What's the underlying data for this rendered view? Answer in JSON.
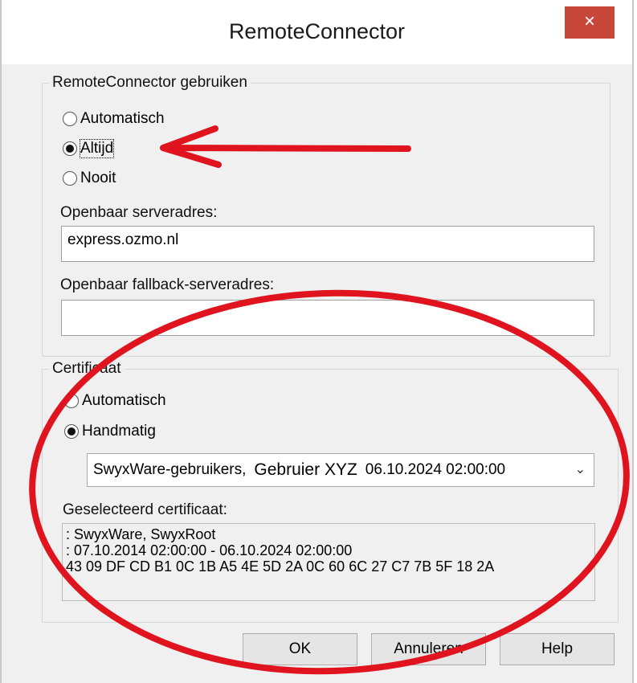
{
  "window": {
    "title": "RemoteConnector",
    "close_label": "×"
  },
  "usage_group": {
    "legend": "RemoteConnector gebruiken",
    "options": [
      "Automatisch",
      "Altijd",
      "Nooit"
    ],
    "selected": "Altijd",
    "server_label": "Openbaar serveradres:",
    "server_value": "express.ozmo.nl",
    "fallback_label": "Openbaar fallback-serveradres:",
    "fallback_value": ""
  },
  "cert_group": {
    "legend": "Certificaat",
    "options": [
      "Automatisch",
      "Handmatig"
    ],
    "selected": "Handmatig",
    "combo_prefix": "SwyxWare-gebruikers,",
    "combo_emphasis": "Gebruier XYZ",
    "combo_suffix": "06.10.2024 02:00:00",
    "selected_label": "Geselecteerd certificaat:",
    "lines": [
      ": SwyxWare, SwyxRoot",
      ": 07.10.2014 02:00:00 - 06.10.2024 02:00:00",
      "43 09 DF CD B1 0C 1B A5 4E 5D 2A 0C 60 6C 27 C7 7B 5F 18 2A"
    ]
  },
  "buttons": {
    "ok": "OK",
    "cancel": "Annuleren",
    "help": "Help"
  },
  "annotation": {
    "color": "#e0141e"
  }
}
